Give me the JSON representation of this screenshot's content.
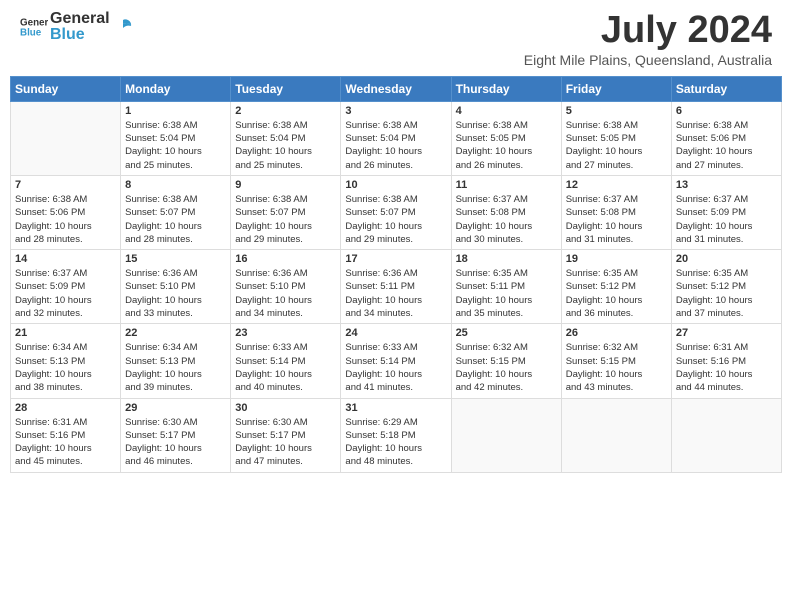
{
  "header": {
    "logo_general": "General",
    "logo_blue": "Blue",
    "main_title": "July 2024",
    "subtitle": "Eight Mile Plains, Queensland, Australia"
  },
  "calendar": {
    "days_of_week": [
      "Sunday",
      "Monday",
      "Tuesday",
      "Wednesday",
      "Thursday",
      "Friday",
      "Saturday"
    ],
    "weeks": [
      [
        {
          "day": "",
          "info": ""
        },
        {
          "day": "1",
          "info": "Sunrise: 6:38 AM\nSunset: 5:04 PM\nDaylight: 10 hours\nand 25 minutes."
        },
        {
          "day": "2",
          "info": "Sunrise: 6:38 AM\nSunset: 5:04 PM\nDaylight: 10 hours\nand 25 minutes."
        },
        {
          "day": "3",
          "info": "Sunrise: 6:38 AM\nSunset: 5:04 PM\nDaylight: 10 hours\nand 26 minutes."
        },
        {
          "day": "4",
          "info": "Sunrise: 6:38 AM\nSunset: 5:05 PM\nDaylight: 10 hours\nand 26 minutes."
        },
        {
          "day": "5",
          "info": "Sunrise: 6:38 AM\nSunset: 5:05 PM\nDaylight: 10 hours\nand 27 minutes."
        },
        {
          "day": "6",
          "info": "Sunrise: 6:38 AM\nSunset: 5:06 PM\nDaylight: 10 hours\nand 27 minutes."
        }
      ],
      [
        {
          "day": "7",
          "info": "Sunrise: 6:38 AM\nSunset: 5:06 PM\nDaylight: 10 hours\nand 28 minutes."
        },
        {
          "day": "8",
          "info": "Sunrise: 6:38 AM\nSunset: 5:07 PM\nDaylight: 10 hours\nand 28 minutes."
        },
        {
          "day": "9",
          "info": "Sunrise: 6:38 AM\nSunset: 5:07 PM\nDaylight: 10 hours\nand 29 minutes."
        },
        {
          "day": "10",
          "info": "Sunrise: 6:38 AM\nSunset: 5:07 PM\nDaylight: 10 hours\nand 29 minutes."
        },
        {
          "day": "11",
          "info": "Sunrise: 6:37 AM\nSunset: 5:08 PM\nDaylight: 10 hours\nand 30 minutes."
        },
        {
          "day": "12",
          "info": "Sunrise: 6:37 AM\nSunset: 5:08 PM\nDaylight: 10 hours\nand 31 minutes."
        },
        {
          "day": "13",
          "info": "Sunrise: 6:37 AM\nSunset: 5:09 PM\nDaylight: 10 hours\nand 31 minutes."
        }
      ],
      [
        {
          "day": "14",
          "info": "Sunrise: 6:37 AM\nSunset: 5:09 PM\nDaylight: 10 hours\nand 32 minutes."
        },
        {
          "day": "15",
          "info": "Sunrise: 6:36 AM\nSunset: 5:10 PM\nDaylight: 10 hours\nand 33 minutes."
        },
        {
          "day": "16",
          "info": "Sunrise: 6:36 AM\nSunset: 5:10 PM\nDaylight: 10 hours\nand 34 minutes."
        },
        {
          "day": "17",
          "info": "Sunrise: 6:36 AM\nSunset: 5:11 PM\nDaylight: 10 hours\nand 34 minutes."
        },
        {
          "day": "18",
          "info": "Sunrise: 6:35 AM\nSunset: 5:11 PM\nDaylight: 10 hours\nand 35 minutes."
        },
        {
          "day": "19",
          "info": "Sunrise: 6:35 AM\nSunset: 5:12 PM\nDaylight: 10 hours\nand 36 minutes."
        },
        {
          "day": "20",
          "info": "Sunrise: 6:35 AM\nSunset: 5:12 PM\nDaylight: 10 hours\nand 37 minutes."
        }
      ],
      [
        {
          "day": "21",
          "info": "Sunrise: 6:34 AM\nSunset: 5:13 PM\nDaylight: 10 hours\nand 38 minutes."
        },
        {
          "day": "22",
          "info": "Sunrise: 6:34 AM\nSunset: 5:13 PM\nDaylight: 10 hours\nand 39 minutes."
        },
        {
          "day": "23",
          "info": "Sunrise: 6:33 AM\nSunset: 5:14 PM\nDaylight: 10 hours\nand 40 minutes."
        },
        {
          "day": "24",
          "info": "Sunrise: 6:33 AM\nSunset: 5:14 PM\nDaylight: 10 hours\nand 41 minutes."
        },
        {
          "day": "25",
          "info": "Sunrise: 6:32 AM\nSunset: 5:15 PM\nDaylight: 10 hours\nand 42 minutes."
        },
        {
          "day": "26",
          "info": "Sunrise: 6:32 AM\nSunset: 5:15 PM\nDaylight: 10 hours\nand 43 minutes."
        },
        {
          "day": "27",
          "info": "Sunrise: 6:31 AM\nSunset: 5:16 PM\nDaylight: 10 hours\nand 44 minutes."
        }
      ],
      [
        {
          "day": "28",
          "info": "Sunrise: 6:31 AM\nSunset: 5:16 PM\nDaylight: 10 hours\nand 45 minutes."
        },
        {
          "day": "29",
          "info": "Sunrise: 6:30 AM\nSunset: 5:17 PM\nDaylight: 10 hours\nand 46 minutes."
        },
        {
          "day": "30",
          "info": "Sunrise: 6:30 AM\nSunset: 5:17 PM\nDaylight: 10 hours\nand 47 minutes."
        },
        {
          "day": "31",
          "info": "Sunrise: 6:29 AM\nSunset: 5:18 PM\nDaylight: 10 hours\nand 48 minutes."
        },
        {
          "day": "",
          "info": ""
        },
        {
          "day": "",
          "info": ""
        },
        {
          "day": "",
          "info": ""
        }
      ]
    ]
  }
}
